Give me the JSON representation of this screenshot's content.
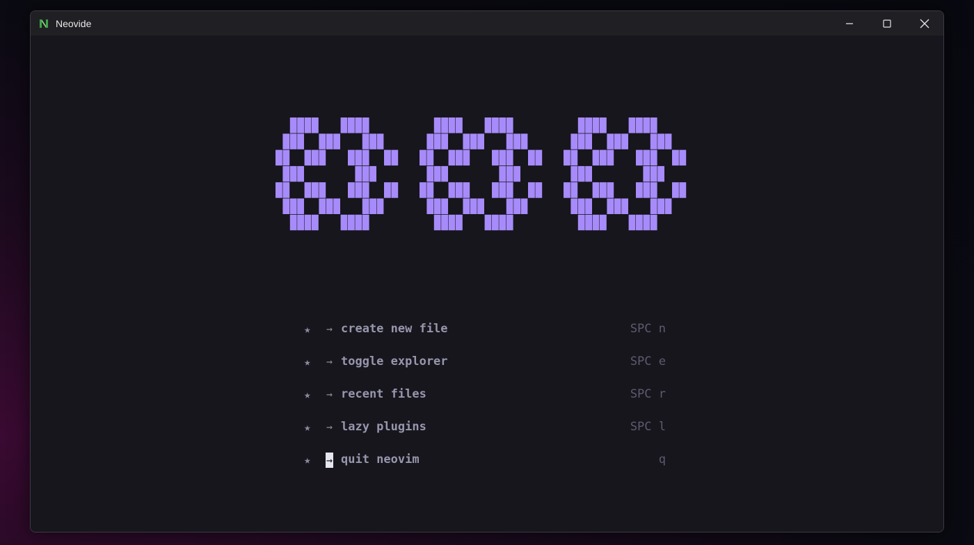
{
  "window": {
    "title": "Neovide",
    "app_icon": "neovide-icon",
    "controls": [
      "minimize-icon",
      "maximize-icon",
      "close-icon"
    ]
  },
  "dashboard": {
    "logo": "pixel-art-logo",
    "accent_color": "#a78bfa",
    "items": [
      {
        "icon": "★",
        "arrow": "→",
        "label": "create new file",
        "key": "SPC n"
      },
      {
        "icon": "★",
        "arrow": "→",
        "label": "toggle explorer",
        "key": "SPC e"
      },
      {
        "icon": "★",
        "arrow": "→",
        "label": "recent files",
        "key": "SPC r"
      },
      {
        "icon": "★",
        "arrow": "→",
        "label": "lazy plugins",
        "key": "SPC l"
      },
      {
        "icon": "★",
        "arrow": "→",
        "label": "quit neovim",
        "key": "q"
      }
    ]
  }
}
